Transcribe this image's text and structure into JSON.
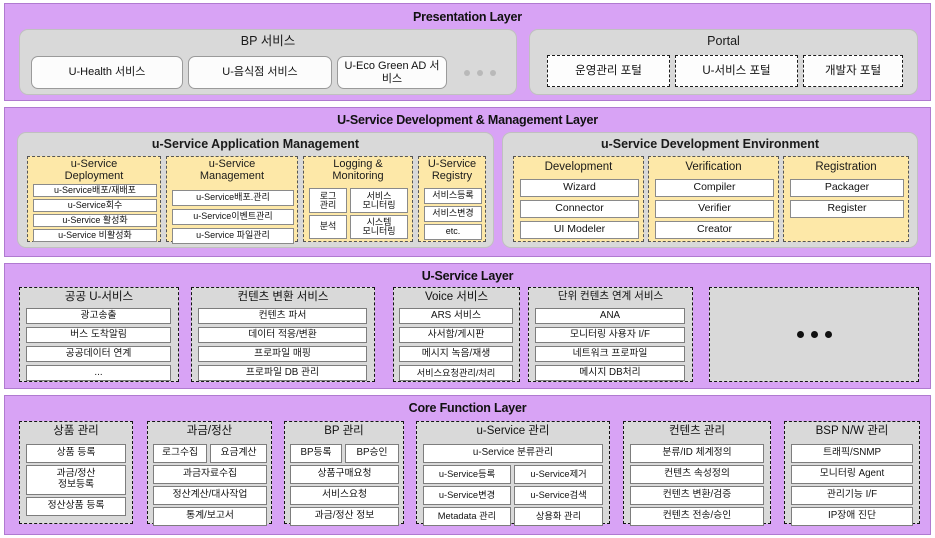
{
  "meta": {
    "colors": {
      "layer_bg": "#d8a3f5",
      "group_bg": "#d9d9d9",
      "panel_yellow": "#fde8a8",
      "leaf_white": "#ffffff",
      "text": "#111111"
    }
  },
  "layers": [
    {
      "id": "presentation",
      "title": "Presentation Layer",
      "groups": [
        {
          "id": "bp-service",
          "title": "BP 서비스",
          "items": [
            "U-Health 서비스",
            "U-음식점 서비스",
            "U-Eco Green AD 서비스"
          ],
          "trailing": "..."
        },
        {
          "id": "portal",
          "title": "Portal",
          "items": [
            "운영관리 포털",
            "U-서비스 포털",
            "개발자 포털"
          ]
        }
      ]
    },
    {
      "id": "dev-mgmt",
      "title": "U-Service Development & Management Layer",
      "groups": [
        {
          "id": "app-management",
          "title": "u-Service Application Management",
          "panels": [
            {
              "id": "deployment",
              "title": "u-Service\nDeployment",
              "title_lines": [
                "u-Service",
                "Deployment"
              ],
              "items": [
                "u-Service배포/재배포",
                "u-Service회수",
                "u-Service 활성화",
                "u-Service 비활성화"
              ]
            },
            {
              "id": "management",
              "title_lines": [
                "u-Service",
                "Management"
              ],
              "items": [
                "u-Service배포.관리",
                "u-Service이벤트관리",
                "u-Service 파일관리"
              ]
            },
            {
              "id": "logging-monitoring",
              "title_lines": [
                "Logging &",
                "Monitoring"
              ],
              "grid_items": [
                "로그\n관리",
                "서비스\n모니터링",
                "분석",
                "시스템\n모니터링"
              ],
              "items_grid": [
                [
                  "로그 관리",
                  "서비스 모니터링"
                ],
                [
                  "분석",
                  "시스템 모니터링"
                ]
              ]
            },
            {
              "id": "registry",
              "title_lines": [
                "U-Service",
                "Registry"
              ],
              "items": [
                "서비스등록",
                "서비스변경",
                "etc."
              ]
            }
          ]
        },
        {
          "id": "dev-environment",
          "title": "u-Service Development Environment",
          "panels": [
            {
              "id": "development",
              "title_lines": [
                "Development"
              ],
              "items": [
                "Wizard",
                "Connector",
                "UI Modeler"
              ]
            },
            {
              "id": "verification",
              "title_lines": [
                "Verification"
              ],
              "items": [
                "Compiler",
                "Verifier",
                "Creator"
              ]
            },
            {
              "id": "registration",
              "title_lines": [
                "Registration"
              ],
              "items": [
                "Packager",
                "Register"
              ]
            }
          ]
        }
      ]
    },
    {
      "id": "u-service",
      "title": "U-Service Layer",
      "groups": [
        {
          "id": "public-u-service",
          "title": "공공 U-서비스",
          "items": [
            "광고송출",
            "버스 도착알림",
            "공공데이터 연계",
            "..."
          ]
        },
        {
          "id": "content-conversion",
          "title": "컨텐츠 변환 서비스",
          "items": [
            "컨텐츠 파서",
            "데이터 적응/변환",
            "프로파일 매핑",
            "프로파일 DB 관리"
          ]
        },
        {
          "id": "voice-service",
          "title": "Voice 서비스",
          "items": [
            "ARS 서비스",
            "사서함/게시판",
            "메시지 녹음/재생",
            "서비스요청관리/처리"
          ]
        },
        {
          "id": "unit-content-link",
          "title": "단위 컨텐츠 연계 서비스",
          "items": [
            "ANA",
            "모니터링 사용자 I/F",
            "네트워크 프로파일",
            "메시지 DB처리"
          ]
        },
        {
          "id": "more-services",
          "title": "",
          "items": [],
          "placeholder_dots": "•••"
        }
      ]
    },
    {
      "id": "core-function",
      "title": "Core Function Layer",
      "groups": [
        {
          "id": "product-management",
          "title": "상품 관리",
          "items": [
            "상품 등록",
            "과금/정산 정보등록",
            "정산상품 등록"
          ],
          "items_lines": [
            [
              "상품 등록"
            ],
            [
              "과금/정산",
              "정보등록"
            ],
            [
              "정산상품 등록"
            ]
          ]
        },
        {
          "id": "billing-settlement",
          "title": "과금/정산",
          "pair": [
            "로그수집",
            "요금계산"
          ],
          "items": [
            "과금자료수집",
            "정산계산/대사작업",
            "통계/보고서"
          ]
        },
        {
          "id": "bp-management",
          "title": "BP 관리",
          "pair": [
            "BP등록",
            "BP승인"
          ],
          "items": [
            "상품구매요청",
            "서비스요청",
            "과금/정산 정보"
          ]
        },
        {
          "id": "u-service-management",
          "title": "u-Service 관리",
          "wide": "u-Service 분류관리",
          "pairs": [
            [
              "u-Service등록",
              "u-Service제거"
            ],
            [
              "u-Service변경",
              "u-Service검색"
            ],
            [
              "Metadata 관리",
              "상용화 관리"
            ]
          ]
        },
        {
          "id": "content-management",
          "title": "컨텐츠 관리",
          "items": [
            "분류/ID 체계정의",
            "컨텐츠 속성정의",
            "컨텐츠 변환/검증",
            "컨텐츠 전송/승인"
          ]
        },
        {
          "id": "bsp-nw-management",
          "title": "BSP N/W 관리",
          "items": [
            "트래픽/SNMP",
            "모니터링 Agent",
            "관리기능 I/F",
            "IP장애 진단"
          ]
        }
      ]
    }
  ]
}
